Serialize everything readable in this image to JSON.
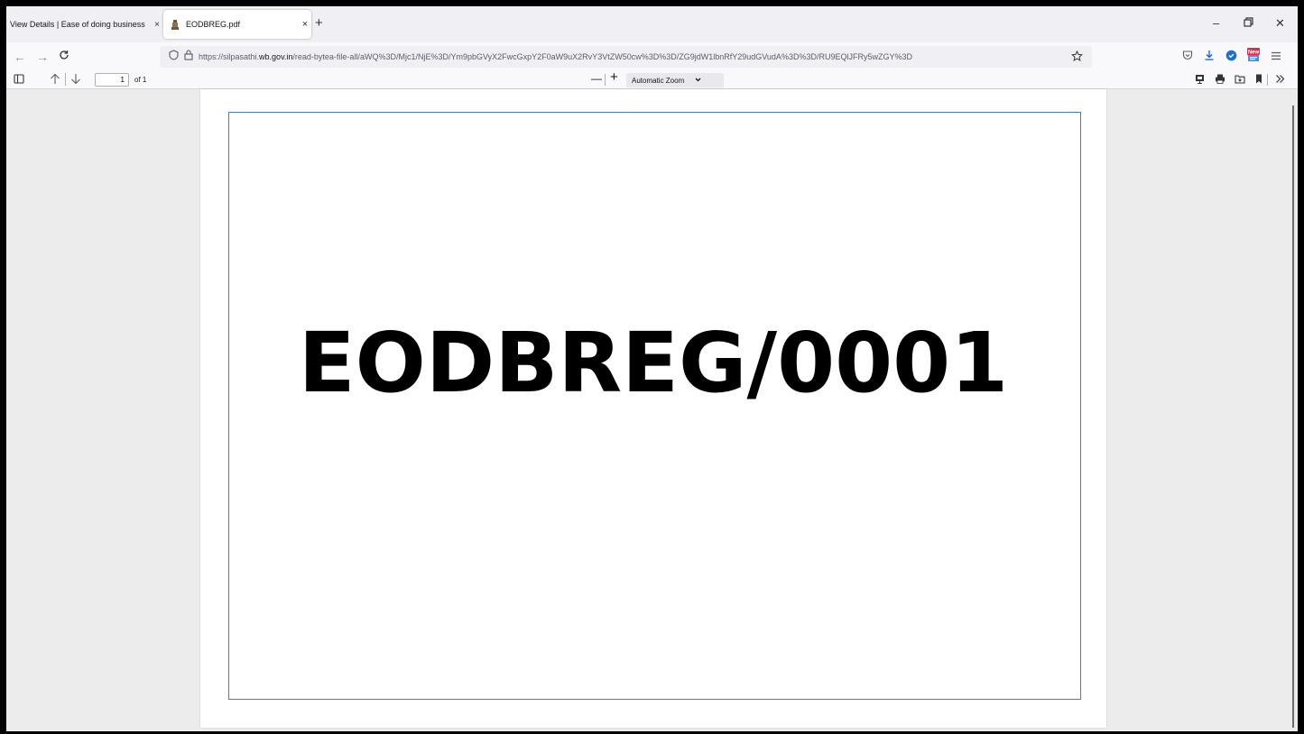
{
  "browser": {
    "tabs": [
      {
        "title": "View Details | Ease of doing business",
        "active": false
      },
      {
        "title": "EODBREG.pdf",
        "active": true
      }
    ],
    "close_symbol": "×",
    "new_tab_symbol": "+",
    "window_controls": {
      "minimize": "–",
      "restore": "⧉",
      "close": "✕"
    },
    "nav": {
      "back": "←",
      "forward": "→",
      "reload": "C"
    },
    "url": {
      "prefix": "https://silpasathi.",
      "domain": "wb.gov.in",
      "path": "/read-bytea-file-all/aWQ%3D/Mjc1/NjE%3D/Ym9pbGVyX2FwcGxpY2F0aW9uX2RvY3VtZW50cw%3D%3D/ZG9jdW1lbnRfY29udGVudA%3D%3D/RU9EQlJFRy5wZGY%3D"
    },
    "icons": [
      "shield-icon",
      "lock-icon",
      "star-icon",
      "pocket-icon",
      "download-icon",
      "extension-icon",
      "new-badge-icon",
      "menu-icon"
    ]
  },
  "pdf_toolbar": {
    "page_current": "1",
    "page_of": "of 1",
    "zoom_out": "—",
    "zoom_in": "+",
    "zoom_label": "Automatic Zoom",
    "zoom_chevron": "⌄"
  },
  "document": {
    "text": "EODBREG/0001"
  },
  "colors": {
    "page_border": "#4a7fab",
    "viewer_bg": "#ececec"
  }
}
